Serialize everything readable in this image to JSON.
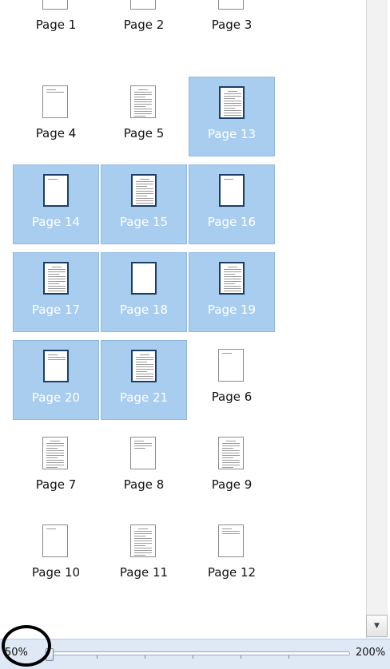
{
  "pages": [
    {
      "label": "Page 1",
      "selected": false,
      "lines": 8
    },
    {
      "label": "Page 2",
      "selected": false,
      "lines": 0
    },
    {
      "label": "Page 3",
      "selected": false,
      "lines": 8
    },
    {
      "label": "Page 4",
      "selected": false,
      "lines": 2
    },
    {
      "label": "Page 5",
      "selected": false,
      "lines": 12
    },
    {
      "label": "Page 13",
      "selected": true,
      "lines": 12
    },
    {
      "label": "Page 14",
      "selected": true,
      "lines": 1
    },
    {
      "label": "Page 15",
      "selected": true,
      "lines": 12
    },
    {
      "label": "Page 16",
      "selected": true,
      "lines": 1
    },
    {
      "label": "Page 17",
      "selected": true,
      "lines": 12
    },
    {
      "label": "Page 18",
      "selected": true,
      "lines": 0
    },
    {
      "label": "Page 19",
      "selected": true,
      "lines": 12
    },
    {
      "label": "Page 20",
      "selected": true,
      "lines": 3
    },
    {
      "label": "Page 21",
      "selected": true,
      "lines": 12
    },
    {
      "label": "Page 6",
      "selected": false,
      "lines": 1
    },
    {
      "label": "Page 7",
      "selected": false,
      "lines": 12
    },
    {
      "label": "Page 8",
      "selected": false,
      "lines": 4
    },
    {
      "label": "Page 9",
      "selected": false,
      "lines": 12
    },
    {
      "label": "Page 10",
      "selected": false,
      "lines": 1
    },
    {
      "label": "Page 11",
      "selected": false,
      "lines": 12
    },
    {
      "label": "Page 12",
      "selected": false,
      "lines": 3
    }
  ],
  "zoom": {
    "min_label": "50%",
    "max_label": "200%",
    "value_percent": 50
  },
  "scrollbar": {
    "down_icon": "triangle-down-icon"
  },
  "colors": {
    "selection": "#a9cdef",
    "annotation": "#000000"
  }
}
